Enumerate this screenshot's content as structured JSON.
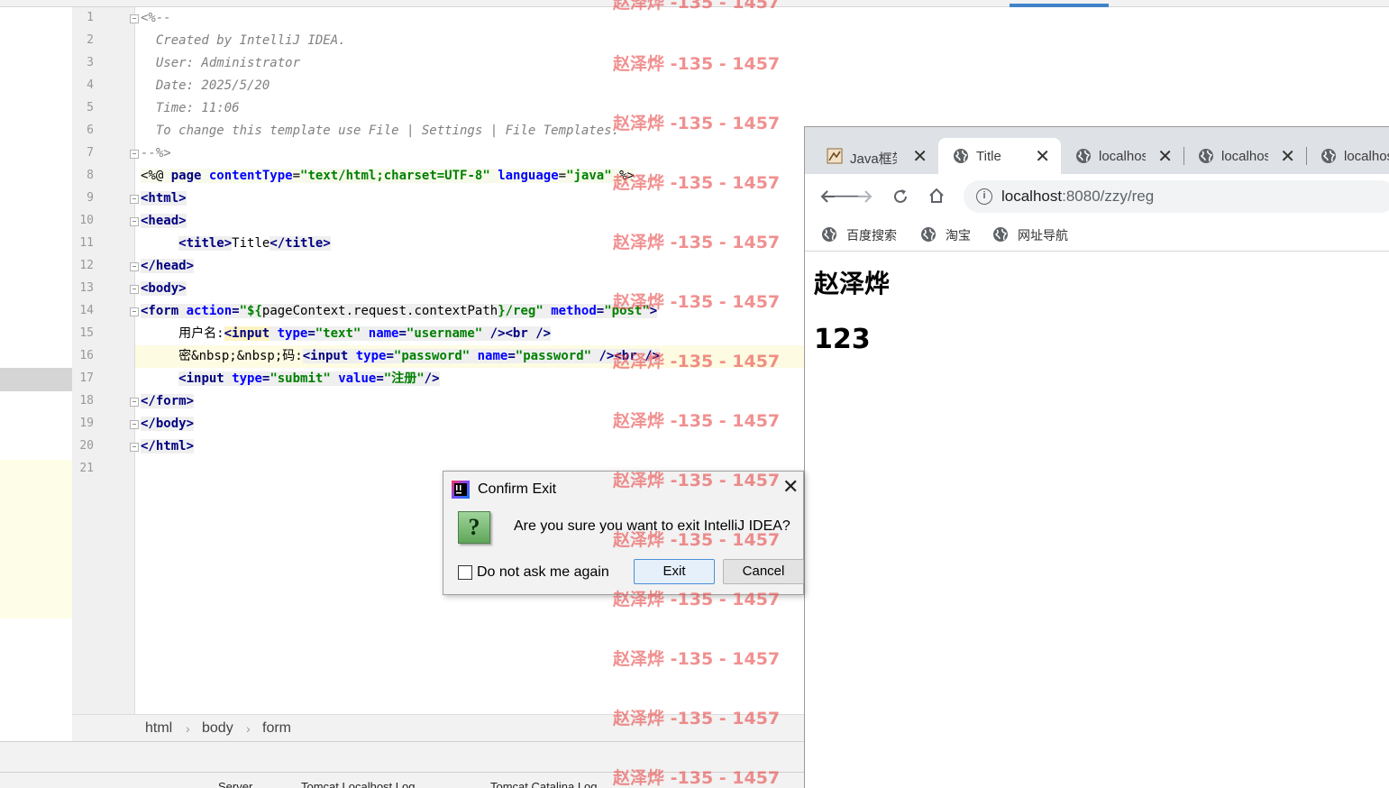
{
  "ide": {
    "code_lines": [
      {
        "n": "1",
        "html": "<span class=\"cm\">&lt;%--</span>"
      },
      {
        "n": "2",
        "html": "<span class=\"cm\">  Created by IntelliJ IDEA.</span>"
      },
      {
        "n": "3",
        "html": "<span class=\"cm\">  User: Administrator</span>"
      },
      {
        "n": "4",
        "html": "<span class=\"cm\">  Date: 2025/5/20</span>"
      },
      {
        "n": "5",
        "html": "<span class=\"cm\">  Time: 11:06</span>"
      },
      {
        "n": "6",
        "html": "<span class=\"cm\">  To change this template use File | Settings | File Templates.</span>"
      },
      {
        "n": "7",
        "html": "<span class=\"cm\">--%&gt;</span>"
      },
      {
        "n": "8",
        "html": "<span class=\"dir\">&lt;%@ <span class=\"kw\">page</span> <span class=\"at\">contentType</span>=<span class=\"st\">\"text/html;charset=UTF-8\"</span> <span class=\"at\">language</span>=<span class=\"st\">\"java\"</span> %&gt;</span>"
      },
      {
        "n": "9",
        "html": "<span class=\"tg\">&lt;html&gt;</span>"
      },
      {
        "n": "10",
        "html": "<span class=\"tg\">&lt;head&gt;</span>"
      },
      {
        "n": "11",
        "html": "     <span class=\"tg\">&lt;title&gt;</span>Title<span class=\"tg\">&lt;/title&gt;</span>"
      },
      {
        "n": "12",
        "html": "<span class=\"tg\">&lt;/head&gt;</span>"
      },
      {
        "n": "13",
        "html": "<span class=\"tg\">&lt;body&gt;</span>"
      },
      {
        "n": "14",
        "html": "<span class=\"tg\">&lt;form <span class=\"at\">action</span>=<span class=\"st\">\"${</span><span style=\"font-weight:normal;color:#000\">pageContext.request.contextPath</span><span class=\"st\">}/reg\"</span> <span class=\"at\">method</span>=<span class=\"st\">\"post\"</span>&gt;</span>"
      },
      {
        "n": "15",
        "html": "     用户名:<span class=\"tg\"><span class=\"hl\">&lt;input</span> <span class=\"at\">type</span>=<span class=\"st\">\"text\"</span> <span class=\"at\">name</span>=<span class=\"st\">\"username\"</span> /&gt;&lt;br /&gt;</span>"
      },
      {
        "n": "16",
        "html": "     密&amp;nbsp;&amp;nbsp;码:<span class=\"tg\">&lt;input <span class=\"at\">type</span>=<span class=\"st\">\"password\"</span> <span class=\"at\">name</span>=<span class=\"st\">\"password\"</span> /&gt;&lt;br /&gt;</span>"
      },
      {
        "n": "17",
        "html": "     <span class=\"tg\">&lt;input <span class=\"at\">type</span>=<span class=\"st\">\"submit\"</span> <span class=\"at\">value</span>=<span class=\"st\">\"注册\"</span>/&gt;</span>"
      },
      {
        "n": "18",
        "html": "<span class=\"tg\">&lt;/form&gt;</span>"
      },
      {
        "n": "19",
        "html": "<span class=\"tg\">&lt;/body&gt;</span>"
      },
      {
        "n": "20",
        "html": "<span class=\"tg\">&lt;/html&gt;</span>"
      },
      {
        "n": "21",
        "html": ""
      }
    ],
    "fold_lines": [
      1,
      7,
      9,
      10,
      12,
      13,
      14,
      18,
      19,
      20
    ],
    "breadcrumbs": [
      "html",
      "body",
      "form"
    ],
    "bottom_tabs": [
      "Server",
      "Tomcat Localhost Log",
      "Tomcat Catalina Log"
    ]
  },
  "browser": {
    "tabs": [
      {
        "label": "Java框架",
        "icon": "java-framework-favicon",
        "active": false
      },
      {
        "label": "Title",
        "icon": "globe-icon",
        "active": true
      },
      {
        "label": "localhost",
        "icon": "globe-icon",
        "active": false
      },
      {
        "label": "localhost",
        "icon": "globe-icon",
        "active": false
      },
      {
        "label": "localhost",
        "icon": "globe-icon",
        "active": false
      }
    ],
    "url_host": "localhost",
    "url_rest": ":8080/zzy/reg",
    "bookmarks": [
      "百度搜索",
      "淘宝",
      "网址导航"
    ],
    "page": {
      "heading1": "赵泽烨",
      "heading2": "123"
    }
  },
  "dialog": {
    "title": "Confirm Exit",
    "message": "Are you sure you want to exit IntelliJ IDEA?",
    "checkbox_label": "Do not ask me again",
    "checkbox_checked": false,
    "exit_label": "Exit",
    "cancel_label": "Cancel"
  },
  "watermark": {
    "text": "赵泽烨 -135 - 1457",
    "color": "#e84646"
  }
}
